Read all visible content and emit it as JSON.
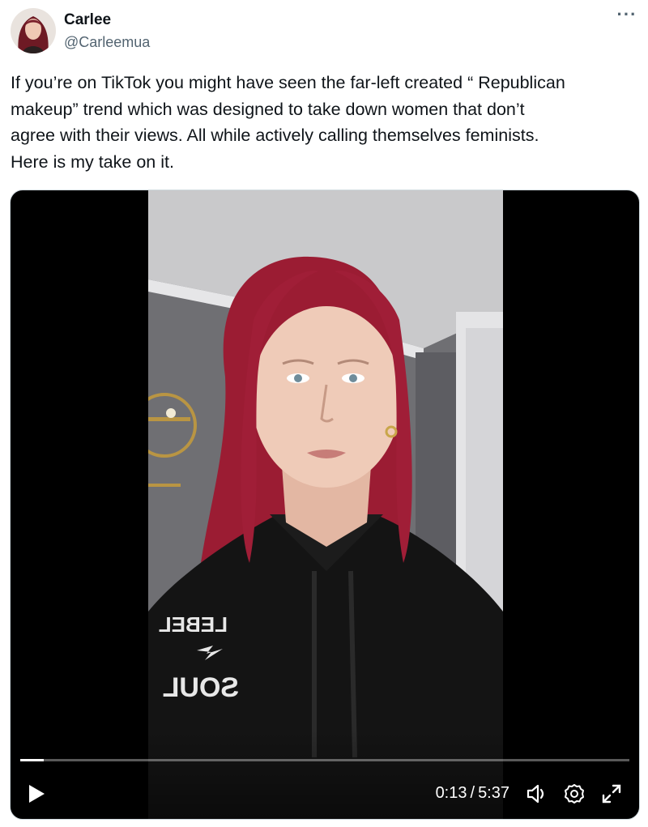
{
  "user": {
    "name": "Carlee",
    "handle": "@Carleemua"
  },
  "tweet": {
    "text": "If you’re on TikTok you might have seen the far-left created “ Republican\nmakeup” trend which was designed to take down women that don’t\nagree with their views. All while actively calling themselves feminists.\nHere is my take on it."
  },
  "video": {
    "current_time": "0:13",
    "separator": "/",
    "duration": "5:37",
    "progress": 0.039,
    "hoodie_print_top": "LEBEL",
    "hoodie_print_bottom": "SOUL",
    "icons": [
      "play-icon",
      "volume-icon",
      "settings-icon",
      "fullscreen-icon"
    ]
  },
  "colors": {
    "text": "#0f1419",
    "secondary": "#536471",
    "hair": "#9b1c33",
    "hoodie": "#141414"
  }
}
